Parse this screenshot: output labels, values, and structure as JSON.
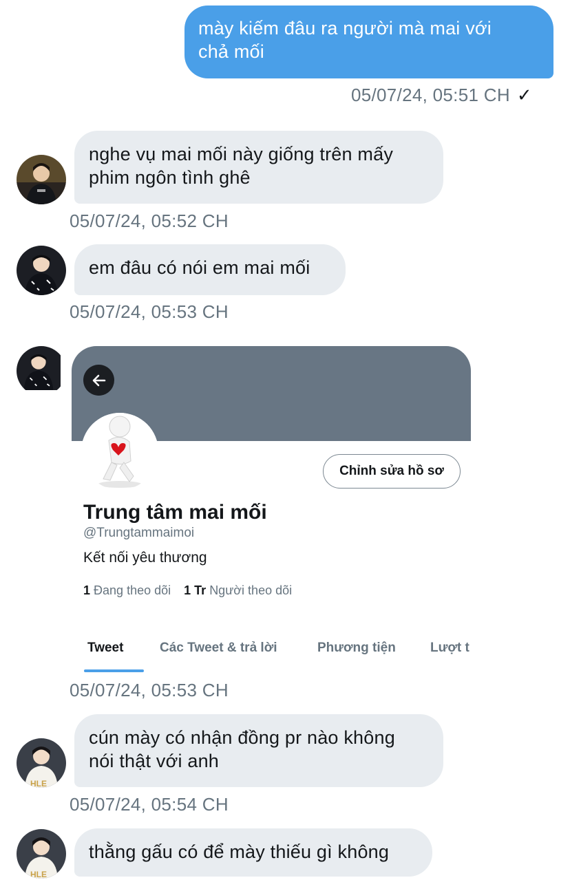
{
  "messages": [
    {
      "direction": "outgoing",
      "text_lines": [
        "mày kiếm đâu ra người mà mai với",
        "chả mối"
      ],
      "time": "05/07/24, 05:51 CH"
    },
    {
      "direction": "incoming",
      "text_lines": [
        "nghe vụ mai mối này giống trên mấy",
        "phim ngôn tình ghê"
      ],
      "time": "05/07/24, 05:52 CH"
    },
    {
      "direction": "incoming",
      "text_lines": [
        "em đâu có nói em mai mối"
      ],
      "time": "05/07/24, 05:53 CH"
    },
    {
      "direction": "incoming",
      "type": "profile_card",
      "time": "05/07/24, 05:53 CH"
    },
    {
      "direction": "incoming",
      "text_lines": [
        "cún mày có nhận đồng pr nào không",
        "nói thật với anh"
      ],
      "time": "05/07/24, 05:54 CH"
    },
    {
      "direction": "incoming",
      "text_lines": [
        "thằng gấu có để mày thiếu gì không"
      ]
    }
  ],
  "read_receipt": "✓",
  "profile_card": {
    "name": "Trung tâm mai mối",
    "handle": "@Trungtammaimoi",
    "bio": "Kết nối yêu thương",
    "edit_button": "Chỉnh sửa hồ sơ",
    "following_count": "1",
    "following_label": "Đang theo dõi",
    "followers_count": "1 Tr",
    "followers_label": "Người theo dõi",
    "tabs": [
      "Tweet",
      "Các Tweet & trả lời",
      "Phương tiện",
      "Lượt t"
    ],
    "active_tab": "Tweet"
  },
  "colors": {
    "outgoing_bubble": "#4a9fe8",
    "incoming_bubble": "#e8ecf0",
    "banner": "#687684",
    "timestamp": "#66747f"
  },
  "icons": [
    "back-arrow-icon",
    "check-icon"
  ]
}
